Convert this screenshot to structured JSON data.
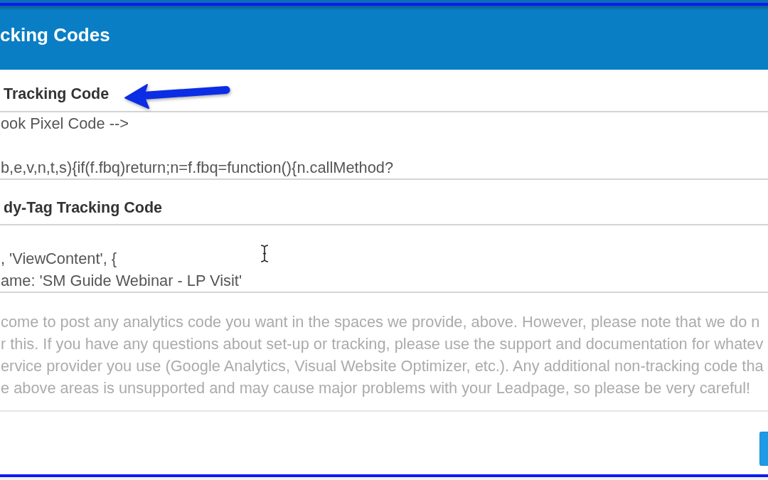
{
  "modal": {
    "title": "cking Codes",
    "sections": [
      {
        "heading": "Tracking Code",
        "callout": {
          "kind": "arrow"
        },
        "code": "ook Pixel Code -->\n\nb,e,v,n,t,s){if(f.fbq)return;n=f.fbq=function(){n.callMethod?"
      },
      {
        "heading": "dy-Tag Tracking Code",
        "code": "\n, 'ViewContent', {\name: 'SM Guide Webinar - LP Visit'"
      }
    ],
    "notice": [
      "come to post any analytics code you want in the spaces we provide, above. However, please note that we do n",
      "r this. If you have any questions about set-up or tracking, please use the support and documentation for whatev",
      "ervice provider you use (Google Analytics, Visual Website Optimizer, etc.). Any additional non-tracking code tha",
      "e above areas is unsupported and may cause major problems with your Leadpage, so please be very careful!"
    ]
  },
  "mouse_pointer": {
    "kind": "text"
  }
}
